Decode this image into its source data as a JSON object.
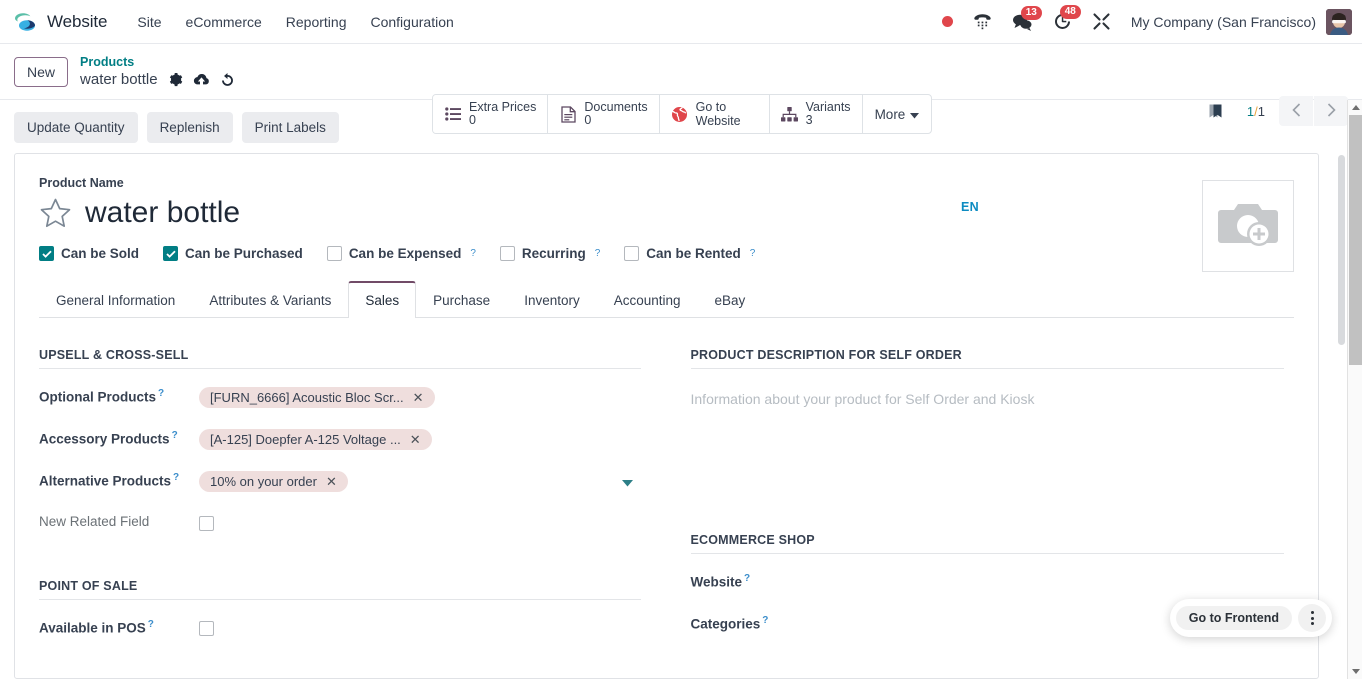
{
  "navbar": {
    "brand": "Website",
    "menu": [
      {
        "label": "Site"
      },
      {
        "label": "eCommerce"
      },
      {
        "label": "Reporting"
      },
      {
        "label": "Configuration"
      }
    ],
    "systray": {
      "recording_icon": "record-dot-icon",
      "voip_icon": "phone-icon",
      "messages_icon": "messages-icon",
      "messages_count": "13",
      "activities_icon": "clock-icon",
      "activities_count": "48",
      "debug_icon": "wrench-icon",
      "company": "My Company (San Francisco)",
      "avatar_icon": "user-avatar"
    }
  },
  "control_panel": {
    "new_label": "New",
    "breadcrumb_parent": "Products",
    "breadcrumb_current": "water bottle",
    "gear_icon": "gear-icon",
    "save_icon": "cloud-upload-icon",
    "discard_icon": "undo-icon",
    "stat_buttons": [
      {
        "icon": "list-icon",
        "label": "Extra Prices",
        "value": "0"
      },
      {
        "icon": "document-icon",
        "label": "Documents",
        "value": "0"
      },
      {
        "icon": "globe-icon",
        "label": "Go to Website",
        "value": ""
      },
      {
        "icon": "hierarchy-icon",
        "label": "Variants",
        "value": "3"
      }
    ],
    "more_label": "More",
    "flag_icon": "bookmark-icon",
    "pager_current": "1",
    "pager_separator": "/",
    "pager_total": "1",
    "prev_icon": "chevron-left-icon",
    "next_icon": "chevron-right-icon"
  },
  "action_buttons": [
    {
      "label": "Update Quantity"
    },
    {
      "label": "Replenish"
    },
    {
      "label": "Print Labels"
    }
  ],
  "form": {
    "product_name_label": "Product Name",
    "product_name": "water bottle",
    "star_icon": "star-outline-icon",
    "language_badge": "EN",
    "image_placeholder_icon": "camera-add-icon",
    "checkboxes": [
      {
        "label": "Can be Sold",
        "checked": true,
        "has_help": false
      },
      {
        "label": "Can be Purchased",
        "checked": true,
        "has_help": false
      },
      {
        "label": "Can be Expensed",
        "checked": false,
        "has_help": true
      },
      {
        "label": "Recurring",
        "checked": false,
        "has_help": true
      },
      {
        "label": "Can be Rented",
        "checked": false,
        "has_help": true
      }
    ],
    "tabs": [
      {
        "label": "General Information",
        "active": false
      },
      {
        "label": "Attributes & Variants",
        "active": false
      },
      {
        "label": "Sales",
        "active": true
      },
      {
        "label": "Purchase",
        "active": false
      },
      {
        "label": "Inventory",
        "active": false
      },
      {
        "label": "Accounting",
        "active": false
      },
      {
        "label": "eBay",
        "active": false
      }
    ],
    "left_groups": [
      {
        "title": "UPSELL & CROSS-SELL",
        "fields": [
          {
            "label": "Optional Products",
            "has_help": true,
            "bold": true,
            "tags": [
              "[FURN_6666] Acoustic Bloc Scr..."
            ],
            "caret": false
          },
          {
            "label": "Accessory Products",
            "has_help": true,
            "bold": true,
            "tags": [
              "[A-125] Doepfer A-125 Voltage ..."
            ],
            "caret": false
          },
          {
            "label": "Alternative Products",
            "has_help": true,
            "bold": true,
            "tags": [
              "10% on your order"
            ],
            "caret": true
          },
          {
            "label": "New Related Field",
            "has_help": false,
            "bold": false,
            "checkbox": true
          }
        ]
      },
      {
        "title": "POINT OF SALE",
        "fields": [
          {
            "label": "Available in POS",
            "has_help": true,
            "bold": true,
            "checkbox": true
          }
        ]
      }
    ],
    "right_groups": [
      {
        "title": "PRODUCT DESCRIPTION FOR SELF ORDER",
        "description_placeholder": "Information about your product for Self Order and Kiosk"
      },
      {
        "title": "ECOMMERCE SHOP",
        "fields": [
          {
            "label": "Website",
            "has_help": true,
            "bold": true
          },
          {
            "label": "Categories",
            "has_help": true,
            "bold": true
          }
        ]
      }
    ]
  },
  "frontend_widget": {
    "label": "Go to Frontend",
    "menu_icon": "vertical-dots-icon"
  },
  "colors": {
    "brand_teal": "#017e84",
    "accent_purple": "#714b67",
    "badge_red": "#e0464b",
    "tag_bg": "#efdedd",
    "link_blue": "#0d8bc1"
  }
}
